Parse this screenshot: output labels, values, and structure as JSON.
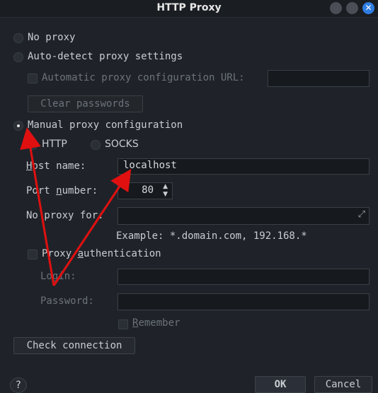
{
  "window": {
    "title": "HTTP Proxy"
  },
  "options": {
    "no_proxy": "No proxy",
    "auto_detect": "Auto-detect proxy settings",
    "auto_config_url_label": "Automatic proxy configuration URL:",
    "clear_passwords": "Clear passwords",
    "manual": "Manual proxy configuration",
    "http": "HTTP",
    "socks": "SOCKS"
  },
  "manual": {
    "host_label_u": "H",
    "host_label_rest": "ost name:",
    "host_value": "localhost",
    "port_label_pre": "Port ",
    "port_label_u": "n",
    "port_label_rest": "umber:",
    "port_value": "80",
    "no_proxy_label": "No proxy for:",
    "example": "Example: *.domain.com, 192.168.*",
    "auth_pre": "Proxy ",
    "auth_u": "a",
    "auth_rest": "uthentication",
    "login_label": "Login:",
    "password_label": "Password:",
    "remember_u": "R",
    "remember_rest": "emember"
  },
  "buttons": {
    "check_connection": "Check connection",
    "help": "?",
    "ok": "OK",
    "cancel": "Cancel"
  },
  "colors": {
    "accent": "#2f7de1",
    "annotation": "#e01010"
  }
}
